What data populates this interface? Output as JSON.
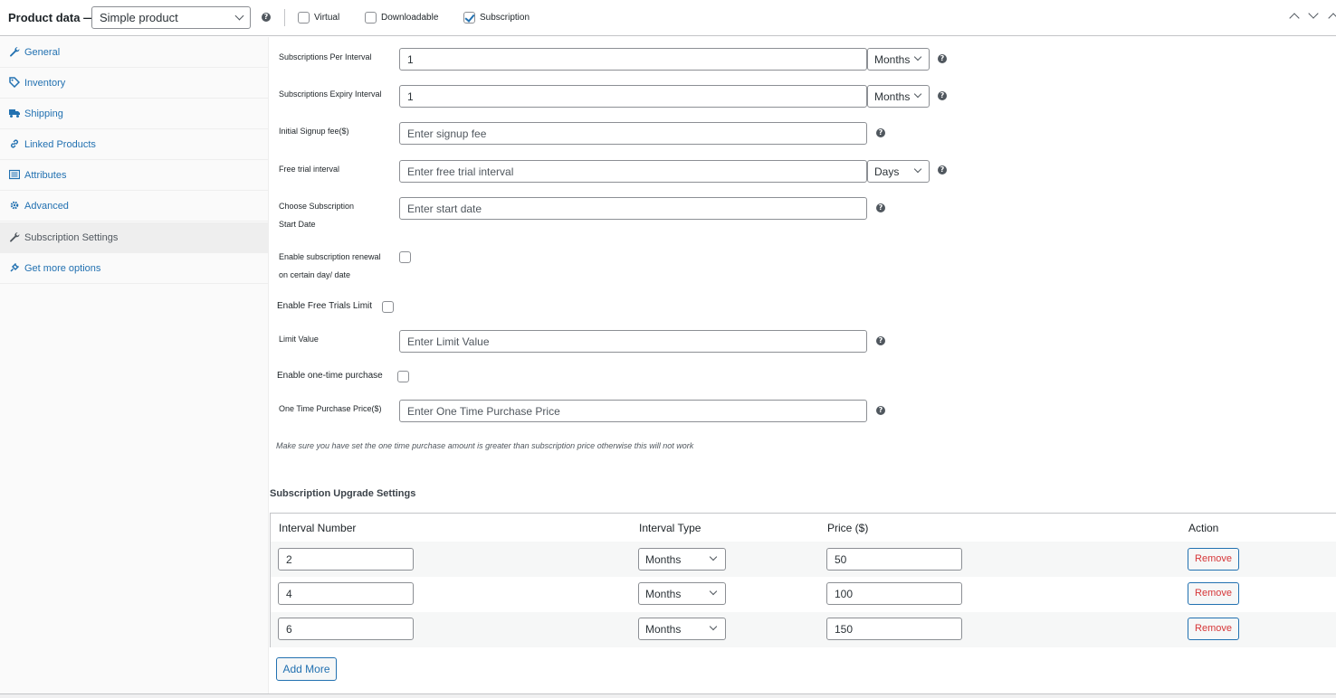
{
  "header": {
    "title": "Product data —",
    "product_type": "Simple product",
    "virtual_label": "Virtual",
    "downloadable_label": "Downloadable",
    "subscription_label": "Subscription",
    "virtual_checked": false,
    "downloadable_checked": false,
    "subscription_checked": true
  },
  "sidebar": {
    "items": [
      {
        "label": "General",
        "icon": "wrench-icon"
      },
      {
        "label": "Inventory",
        "icon": "tag-icon"
      },
      {
        "label": "Shipping",
        "icon": "truck-icon"
      },
      {
        "label": "Linked Products",
        "icon": "link-icon"
      },
      {
        "label": "Attributes",
        "icon": "list-icon"
      },
      {
        "label": "Advanced",
        "icon": "gear-icon"
      },
      {
        "label": "Subscription Settings",
        "icon": "wrench-icon",
        "active": true
      },
      {
        "label": "Get more options",
        "icon": "plugin-icon"
      }
    ]
  },
  "form": {
    "per_interval_label": "Subscriptions Per Interval",
    "per_interval_value": "1",
    "per_interval_unit": "Months",
    "expiry_label": "Subscriptions Expiry Interval",
    "expiry_value": "1",
    "expiry_unit": "Months",
    "signup_label": "Initial Signup fee($)",
    "signup_placeholder": "Enter signup fee",
    "trial_label": "Free trial interval",
    "trial_placeholder": "Enter free trial interval",
    "trial_unit": "Days",
    "start_label_1": "Choose Subscription",
    "start_label_2": "Start Date",
    "start_placeholder": "Enter start date",
    "renewal_label_1": "Enable subscription renewal",
    "renewal_label_2": "on certain day/ date",
    "free_trials_limit_label": "Enable Free Trials Limit",
    "limit_label": "Limit Value",
    "limit_placeholder": "Enter Limit Value",
    "one_time_label": "Enable one-time purchase",
    "one_time_price_label": "One Time Purchase Price($)",
    "one_time_price_placeholder": "Enter One Time Purchase Price",
    "note": "Make sure you have set the one time purchase amount is greater than subscription price otherwise this will not work"
  },
  "upgrade": {
    "title": "Subscription Upgrade Settings",
    "columns": [
      "Interval Number",
      "Interval Type",
      "Price ($)",
      "Action"
    ],
    "rows": [
      {
        "interval": "2",
        "type": "Months",
        "price": "50",
        "action": "Remove"
      },
      {
        "interval": "4",
        "type": "Months",
        "price": "100",
        "action": "Remove"
      },
      {
        "interval": "6",
        "type": "Months",
        "price": "150",
        "action": "Remove"
      }
    ],
    "add_more": "Add More"
  },
  "help_glyph": "?"
}
